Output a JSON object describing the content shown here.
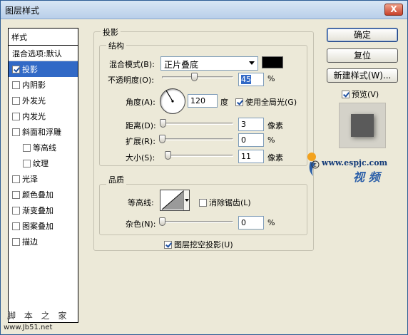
{
  "window": {
    "title": "图层样式",
    "close": "X"
  },
  "left_panel": {
    "header": "样式",
    "items": [
      {
        "label": "混合选项:默认",
        "has_checkbox": false,
        "checked": false,
        "selected": false,
        "indent": false
      },
      {
        "label": "投影",
        "has_checkbox": true,
        "checked": true,
        "selected": true,
        "indent": false
      },
      {
        "label": "内阴影",
        "has_checkbox": true,
        "checked": false,
        "selected": false,
        "indent": false
      },
      {
        "label": "外发光",
        "has_checkbox": true,
        "checked": false,
        "selected": false,
        "indent": false
      },
      {
        "label": "内发光",
        "has_checkbox": true,
        "checked": false,
        "selected": false,
        "indent": false
      },
      {
        "label": "斜面和浮雕",
        "has_checkbox": true,
        "checked": false,
        "selected": false,
        "indent": false
      },
      {
        "label": "等高线",
        "has_checkbox": true,
        "checked": false,
        "selected": false,
        "indent": true
      },
      {
        "label": "纹理",
        "has_checkbox": true,
        "checked": false,
        "selected": false,
        "indent": true
      },
      {
        "label": "光泽",
        "has_checkbox": true,
        "checked": false,
        "selected": false,
        "indent": false
      },
      {
        "label": "颜色叠加",
        "has_checkbox": true,
        "checked": false,
        "selected": false,
        "indent": false
      },
      {
        "label": "渐变叠加",
        "has_checkbox": true,
        "checked": false,
        "selected": false,
        "indent": false
      },
      {
        "label": "图案叠加",
        "has_checkbox": true,
        "checked": false,
        "selected": false,
        "indent": false
      },
      {
        "label": "描边",
        "has_checkbox": true,
        "checked": false,
        "selected": false,
        "indent": false
      }
    ]
  },
  "drop_shadow": {
    "section_title": "投影",
    "structure": {
      "title": "结构",
      "blend_mode_label": "混合模式(B):",
      "blend_mode_value": "正片叠底",
      "shadow_color": "#000000",
      "opacity_label": "不透明度(O):",
      "opacity_value": "45",
      "opacity_unit": "%",
      "opacity_level": 0.45,
      "angle_label": "角度(A):",
      "angle_value": "120",
      "angle_unit": "度",
      "global_light_label": "使用全局光(G)",
      "global_light_checked": true,
      "distance_label": "距离(D):",
      "distance_value": "3",
      "distance_unit": "像素",
      "distance_level": 0.01,
      "spread_label": "扩展(R):",
      "spread_value": "0",
      "spread_unit": "%",
      "spread_level": 0,
      "size_label": "大小(S):",
      "size_value": "11",
      "size_unit": "像素",
      "size_level": 0.045
    },
    "quality": {
      "title": "品质",
      "contour_label": "等高线:",
      "anti_alias_label": "消除锯齿(L)",
      "anti_alias_checked": false,
      "noise_label": "杂色(N):",
      "noise_value": "0",
      "noise_unit": "%",
      "noise_level": 0
    },
    "knockout_label": "图层挖空投影(U)",
    "knockout_checked": true
  },
  "buttons": {
    "ok": "确定",
    "reset": "复位",
    "new_style": "新建样式(W)...",
    "preview_label": "预览(V)",
    "preview_checked": true
  },
  "watermark": {
    "logo_url": "www.espjc.com",
    "logo_text": "视 频",
    "site_name": "脚 本 之 家",
    "site_url": "www.Jb51.net"
  }
}
